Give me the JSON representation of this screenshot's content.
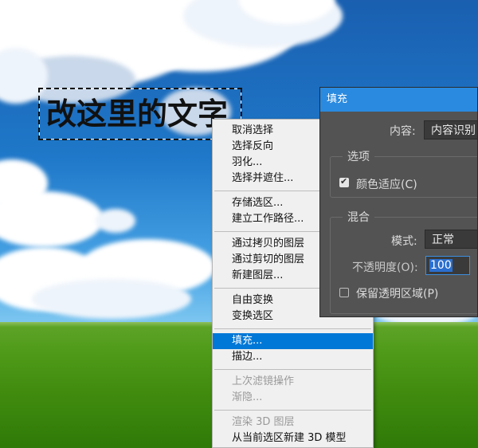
{
  "canvas_text": "改这里的文字",
  "context_menu": {
    "groups": [
      [
        {
          "label": "取消选择"
        },
        {
          "label": "选择反向"
        },
        {
          "label": "羽化..."
        },
        {
          "label": "选择并遮住..."
        }
      ],
      [
        {
          "label": "存储选区..."
        },
        {
          "label": "建立工作路径..."
        }
      ],
      [
        {
          "label": "通过拷贝的图层"
        },
        {
          "label": "通过剪切的图层"
        },
        {
          "label": "新建图层..."
        }
      ],
      [
        {
          "label": "自由变换"
        },
        {
          "label": "变换选区"
        }
      ],
      [
        {
          "label": "填充...",
          "highlighted": true
        },
        {
          "label": "描边..."
        }
      ],
      [
        {
          "label": "上次滤镜操作",
          "disabled": true
        },
        {
          "label": "渐隐...",
          "disabled": true
        }
      ],
      [
        {
          "label": "渲染 3D 图层",
          "disabled": true
        },
        {
          "label": "从当前选区新建 3D 模型"
        }
      ]
    ]
  },
  "fill_dialog": {
    "title": "填充",
    "contents_label": "内容:",
    "contents_value": "内容识别",
    "options_group": "选项",
    "color_adapt_label": "颜色适应(C)",
    "color_adapt_checked": true,
    "blend_group": "混合",
    "mode_label": "模式:",
    "mode_value": "正常",
    "opacity_label": "不透明度(O):",
    "opacity_value": "100",
    "preserve_label": "保留透明区域(P)",
    "preserve_checked": false,
    "title_bar_color": "#2a8ae0"
  },
  "menu_highlight_color": "#0078d7"
}
